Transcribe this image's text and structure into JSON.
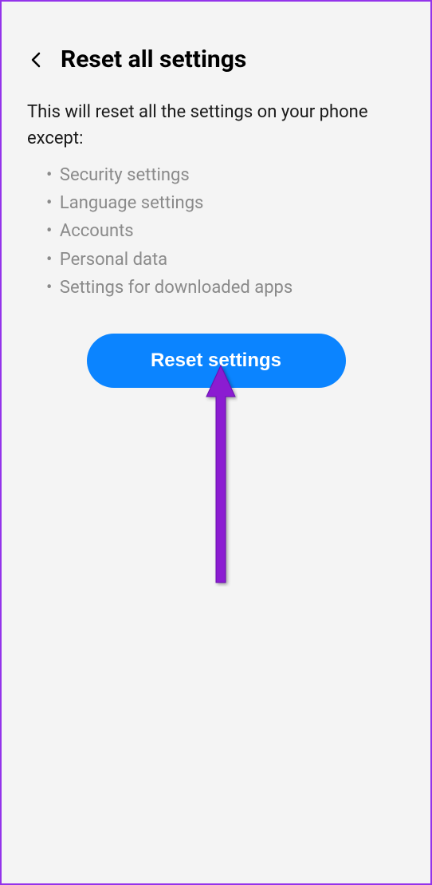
{
  "header": {
    "title": "Reset all settings"
  },
  "description": "This will reset all the settings on your phone except:",
  "exceptions": [
    "Security settings",
    "Language settings",
    "Accounts",
    "Personal data",
    "Settings for downloaded apps"
  ],
  "button": {
    "label": "Reset settings"
  }
}
